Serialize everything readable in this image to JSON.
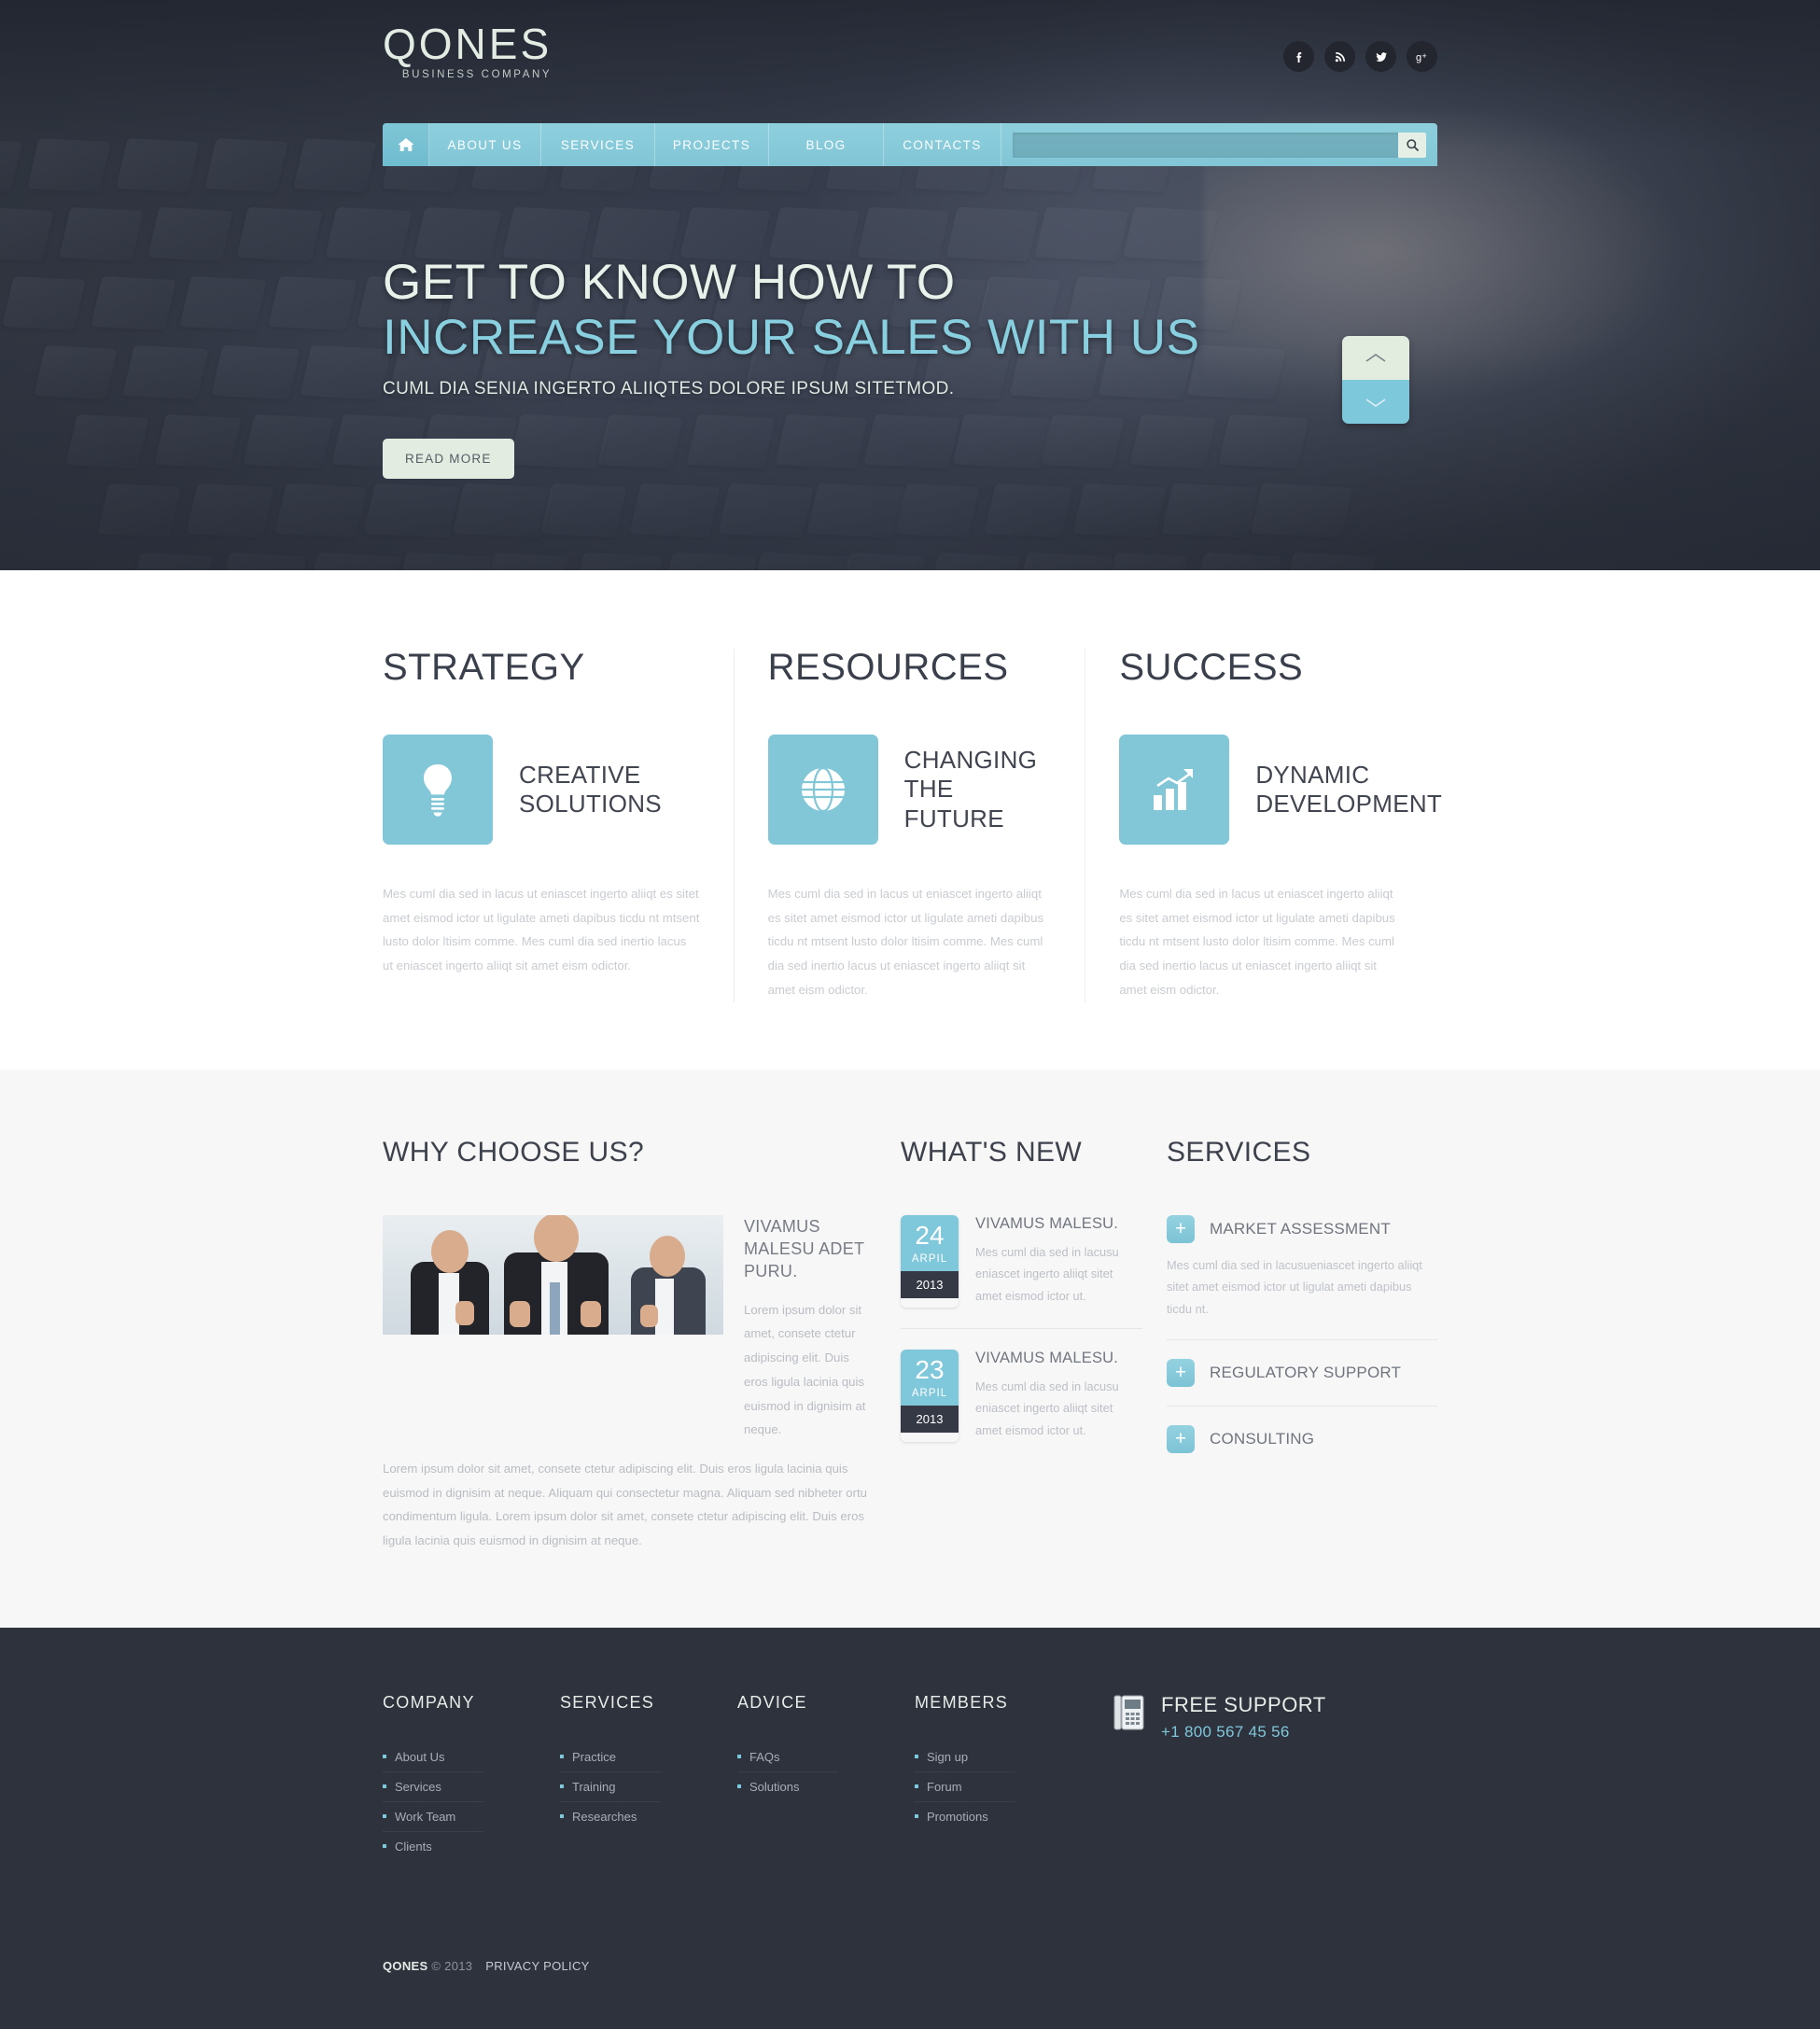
{
  "header": {
    "logo_name": "QONES",
    "logo_tagline": "BUSINESS COMPANY",
    "socials": [
      {
        "name": "facebook-icon",
        "label": "f"
      },
      {
        "name": "rss-icon",
        "label": "RSS"
      },
      {
        "name": "twitter-icon",
        "label": "t"
      },
      {
        "name": "google-plus-icon",
        "label": "g+"
      }
    ]
  },
  "nav": {
    "home_label": "HOME",
    "items": [
      {
        "label": "ABOUT US"
      },
      {
        "label": "SERVICES"
      },
      {
        "label": "PROJECTS"
      },
      {
        "label": "BLOG"
      },
      {
        "label": "CONTACTS"
      }
    ],
    "search_value": "",
    "search_placeholder": ""
  },
  "hero": {
    "title_line1": "GET TO KNOW HOW TO",
    "title_line2": "INCREASE YOUR SALES WITH US",
    "subtitle": "CUML DIA SENIA INGERTO ALIIQTES DOLORE IPSUM SITETMOD.",
    "button": "READ MORE",
    "slider_up": "prev-slide",
    "slider_down": "next-slide"
  },
  "features": [
    {
      "heading": "STRATEGY",
      "icon": "lightbulb-icon",
      "label_line1": "CREATIVE",
      "label_line2": "SOLUTIONS",
      "text": "Mes cuml dia sed in lacus ut eniascet ingerto aliiqt es sitet amet eismod ictor ut ligulate ameti dapibus ticdu nt mtsent lusto dolor ltisim comme. Mes cuml dia sed inertio lacus ut eniascet ingerto aliiqt sit amet eism odictor."
    },
    {
      "heading": "RESOURCES",
      "icon": "globe-icon",
      "label_line1": "CHANGING",
      "label_line2": "THE FUTURE",
      "text": "Mes cuml dia sed in lacus ut eniascet ingerto aliiqt es sitet amet eismod ictor ut ligulate ameti dapibus ticdu nt mtsent lusto dolor ltisim comme. Mes cuml dia sed inertio lacus ut eniascet ingerto aliiqt sit amet eism odictor."
    },
    {
      "heading": "SUCCESS",
      "icon": "growth-chart-icon",
      "label_line1": "DYNAMIC",
      "label_line2": "DEVELOPMENT",
      "text": "Mes cuml dia sed in lacus ut eniascet ingerto aliiqt es sitet amet eismod ictor ut ligulate ameti dapibus ticdu nt mtsent lusto dolor ltisim comme. Mes cuml dia sed inertio lacus ut eniascet ingerto aliiqt sit amet eism odictor."
    }
  ],
  "why": {
    "heading": "WHY CHOOSE US?",
    "image_alt": "team-photo",
    "subtitle": "VIVAMUS MALESU ADET PURU.",
    "text_right": "Lorem ipsum dolor sit amet, consete ctetur adipiscing elit. Duis eros ligula lacinia quis euismod in dignisim at neque.",
    "text_bottom": "Lorem ipsum dolor sit amet, consete ctetur adipiscing elit. Duis eros ligula lacinia quis euismod in dignisim at neque. Aliquam qui consectetur magna. Aliquam sed nibheter ortu condimentum ligula. Lorem ipsum dolor sit amet, consete ctetur adipiscing elit. Duis eros ligula lacinia quis euismod in dignisim at neque."
  },
  "news": {
    "heading": "WHAT'S NEW",
    "items": [
      {
        "day": "24",
        "month": "ARPIL",
        "year": "2013",
        "title": "VIVAMUS MALESU.",
        "text": "Mes cuml dia sed in lacusu eniascet ingerto aliiqt sitet amet eismod ictor ut."
      },
      {
        "day": "23",
        "month": "ARPIL",
        "year": "2013",
        "title": "VIVAMUS MALESU.",
        "text": "Mes cuml dia sed in lacusu eniascet ingerto aliiqt sitet amet eismod ictor ut."
      }
    ]
  },
  "services": {
    "heading": "SERVICES",
    "items": [
      {
        "plus": "+",
        "title": "MARKET ASSESSMENT",
        "text": "Mes cuml dia sed in lacusueniascet ingerto aliiqt sitet amet eismod ictor ut ligulat ameti dapibus ticdu nt."
      },
      {
        "plus": "+",
        "title": "REGULATORY SUPPORT",
        "text": ""
      },
      {
        "plus": "+",
        "title": "CONSULTING",
        "text": ""
      }
    ]
  },
  "footer": {
    "columns": [
      {
        "heading": "COMPANY",
        "links": [
          {
            "label": "About Us"
          },
          {
            "label": "Services"
          },
          {
            "label": "Work Team"
          },
          {
            "label": "Clients"
          }
        ]
      },
      {
        "heading": "SERVICES",
        "links": [
          {
            "label": "Practice"
          },
          {
            "label": "Training"
          },
          {
            "label": "Researches"
          }
        ]
      },
      {
        "heading": "ADVICE",
        "links": [
          {
            "label": "FAQs"
          },
          {
            "label": "Solutions"
          }
        ]
      },
      {
        "heading": "MEMBERS",
        "links": [
          {
            "label": "Sign up"
          },
          {
            "label": "Forum"
          },
          {
            "label": "Promotions"
          }
        ]
      }
    ],
    "support": {
      "icon": "phone-icon",
      "title": "FREE SUPPORT",
      "number": "+1 800 567 45 56"
    },
    "copyright_brand": "QONES",
    "copyright_text": "© 2013",
    "privacy": "PRIVACY POLICY"
  },
  "colors": {
    "accent": "#7fc7da",
    "dark": "#2e323c",
    "mint": "#e2ece1"
  }
}
